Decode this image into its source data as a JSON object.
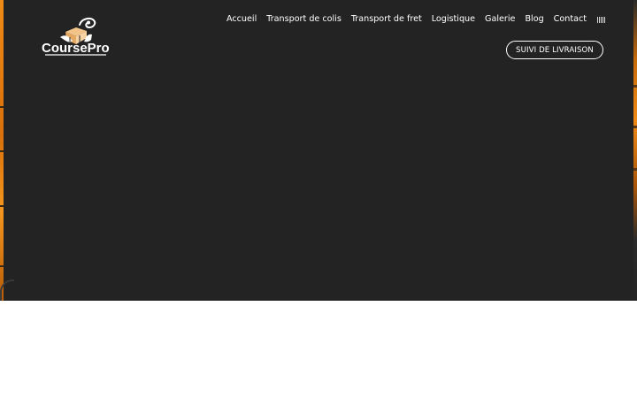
{
  "brand": {
    "logo_text": "CoursePro",
    "logo_icon": "courier-handshake-icon",
    "accent_color": "#f3c48a"
  },
  "nav": {
    "items": [
      {
        "label": "Accueil"
      },
      {
        "label": "Transport de colis"
      },
      {
        "label": "Transport de fret"
      },
      {
        "label": "Logistique"
      },
      {
        "label": "Galerie"
      },
      {
        "label": "Blog"
      },
      {
        "label": "Contact"
      }
    ],
    "menu_icon": "barcode-menu-icon"
  },
  "cta": {
    "label": "SUIVI DE LIVRAISON"
  },
  "theme": {
    "hero_background": "#232323",
    "edge_orange": "#f08a16",
    "page_background": "#ffffff"
  }
}
